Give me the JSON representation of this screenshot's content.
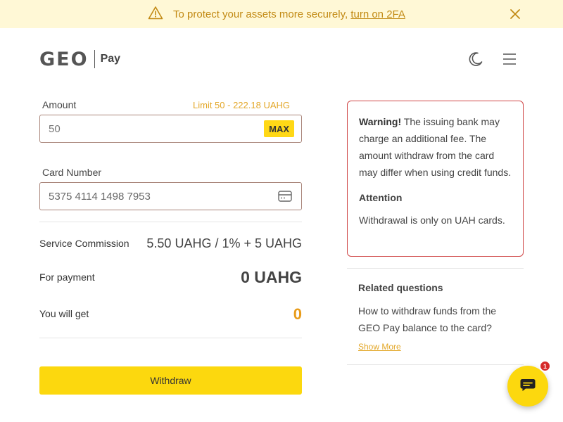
{
  "banner": {
    "text": "To protect your assets more securely,",
    "link": "turn on 2FA",
    "icon": "warning-triangle-icon",
    "close_icon": "close-icon"
  },
  "header": {
    "logo_main": "GEO",
    "logo_sub": "Pay",
    "theme_icon": "moon-icon",
    "menu_icon": "hamburger-menu-icon"
  },
  "form": {
    "amount_label": "Amount",
    "limit": "Limit 50 - 222.18 UAHG",
    "amount_placeholder": "50",
    "max_label": "MAX",
    "card_label": "Card Number",
    "card_value": "5375 4114 1498 7953",
    "card_icon": "credit-card-icon"
  },
  "summary": {
    "commission_label": "Service Commission",
    "commission_value": "5.50 UAHG / 1% + 5 UAHG",
    "payment_label": "For payment",
    "payment_value": "0 UAHG",
    "get_label": "You will get",
    "get_value": "0"
  },
  "withdraw_label": "Withdraw",
  "warning": {
    "title": "Warning!",
    "text": "The issuing bank may charge an additional fee. The amount withdraw from the card may differ when using credit funds.",
    "attention_title": "Attention",
    "attention_text": "Withdrawal is only on UAH cards."
  },
  "related": {
    "title": "Related questions",
    "question": "How to withdraw funds from the GEO Pay balance to the card?",
    "show_more": "Show More"
  },
  "chat": {
    "icon": "chat-icon",
    "badge": "1"
  },
  "colors": {
    "accent_yellow": "#fcd80e",
    "banner_bg": "#fff8d6",
    "warning_red": "#d04848",
    "orange": "#e89b19"
  }
}
